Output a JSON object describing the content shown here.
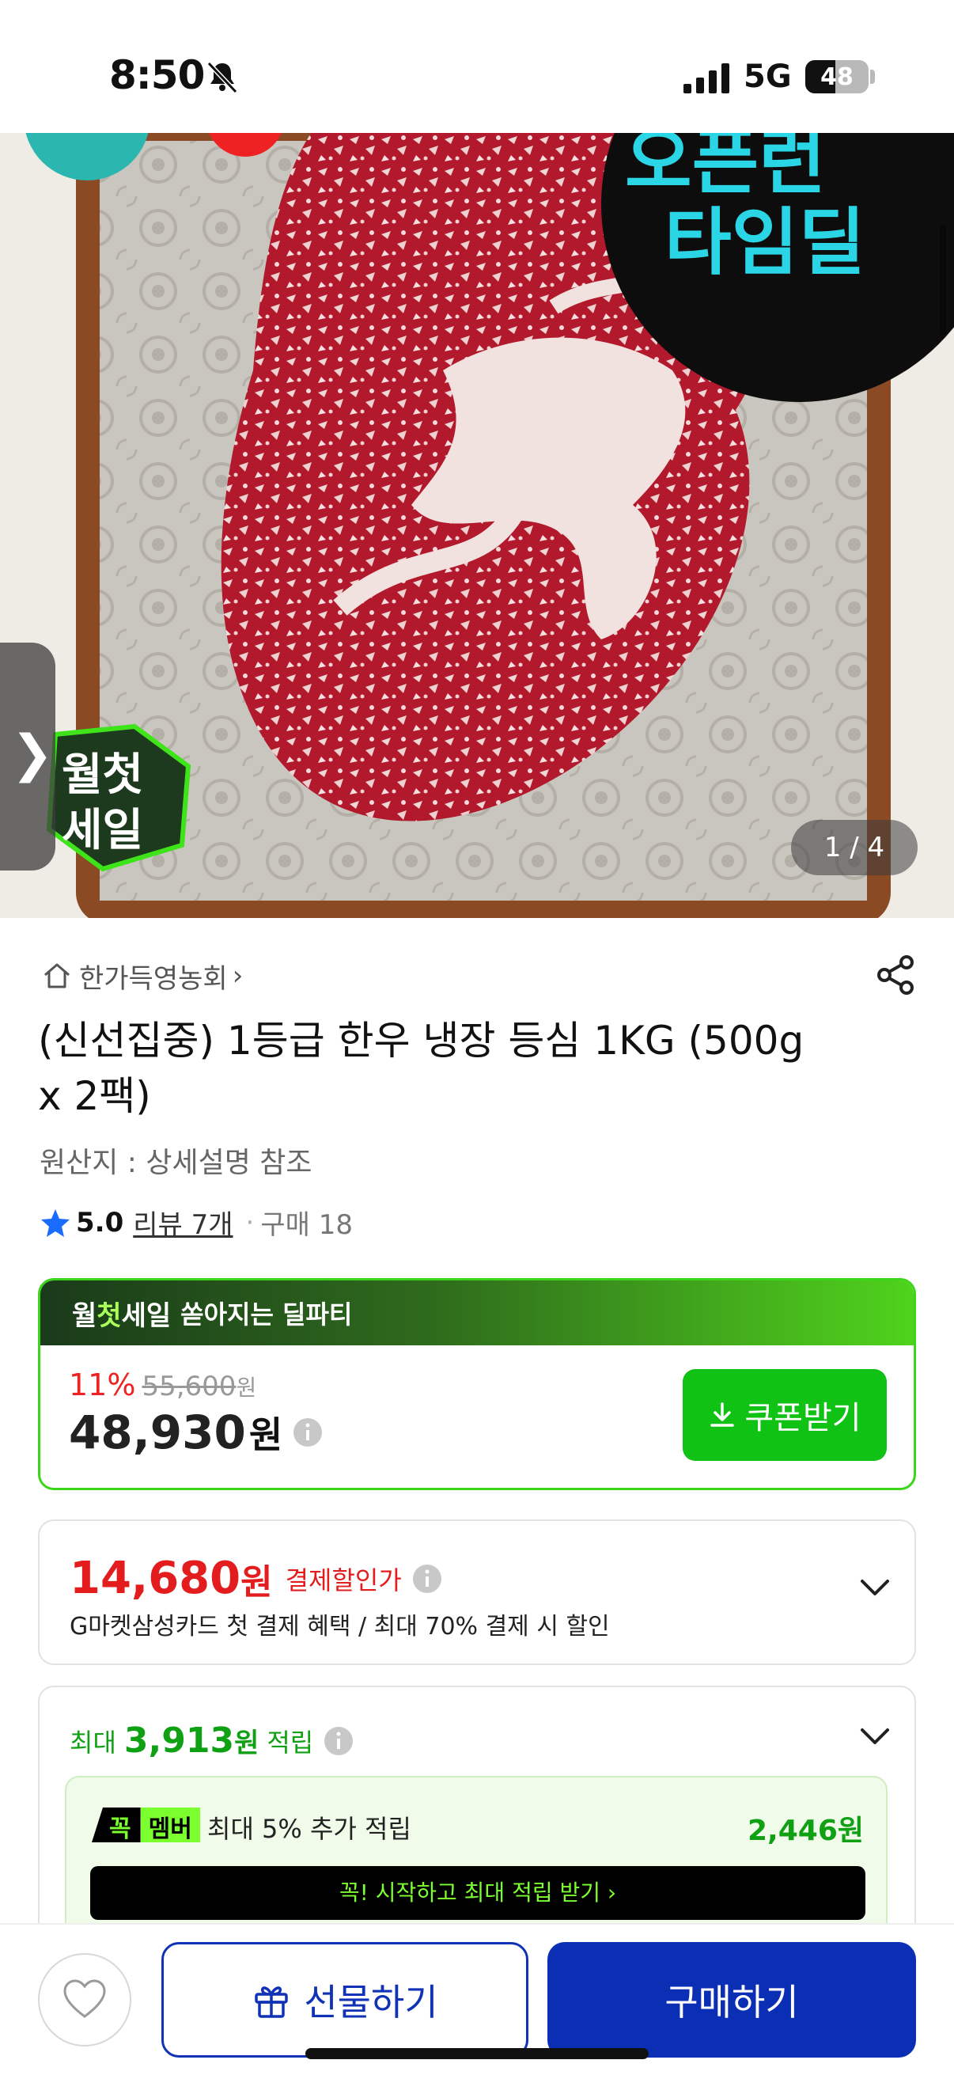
{
  "status_bar": {
    "time": "8:50",
    "network": "5G",
    "battery": "48",
    "battery_level": 0.48
  },
  "hero": {
    "badge_line1": "오픈런",
    "badge_line2": "타임딜",
    "sale_logo_line1": "월첫",
    "sale_logo_line2": "세일",
    "page_indicator": "1 / 4",
    "prev_arrow": "❯"
  },
  "product": {
    "store": "한가득영농회",
    "store_chevron": "›",
    "title": "(신선집중) 1등급 한우 냉장 등심 1KG (500g x 2팩)",
    "origin": "원산지 : 상세설명 참조",
    "rating": "5.0",
    "reviews": "리뷰 7개",
    "dot": "·",
    "purchases": "구매 18"
  },
  "sale": {
    "brand_pre": "월",
    "brand_hl": "첫",
    "brand_post": "세일",
    "subtitle": "쏟아지는 딜파티",
    "discount": "11%",
    "original_price": "55,600",
    "original_won": "원",
    "price": "48,930",
    "price_won": "원",
    "coupon_button": "쿠폰받기"
  },
  "payment": {
    "price": "14,680",
    "won": "원",
    "label": "결제할인가",
    "description": "G마켓삼성카드 첫 결제 혜택 / 최대 70% 결제 시 할인"
  },
  "points": {
    "prefix": "최대",
    "amount": "3,913",
    "won": "원",
    "suffix": "적립",
    "member_badge_a": "꼭",
    "member_badge_b": "멤버",
    "member_text": "최대 5% 추가 적립",
    "member_amount": "2,446원",
    "member_cta": "꼭! 시작하고 최대 적립 받기  ›"
  },
  "bottom_bar": {
    "gift_button": "선물하기",
    "buy_button": "구매하기"
  },
  "colors": {
    "brand_blue": "#0b2fb4",
    "sale_green": "#10c214",
    "price_red": "#e31d1d",
    "points_green": "#10a014"
  }
}
